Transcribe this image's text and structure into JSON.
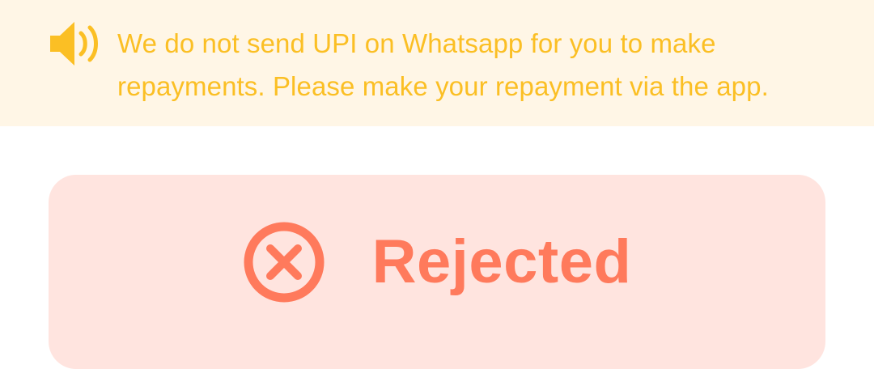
{
  "notice": {
    "icon": "speaker-icon",
    "line1": "We do not send UPI on Whatsapp for you to make",
    "line2": "repayments. Please make your repayment via the app.",
    "color": "#fbbf24",
    "background": "#fff6e6"
  },
  "status": {
    "label": "Rejected",
    "icon": "rejected-circle-x-icon",
    "color": "#ff7a5c",
    "background": "#ffe4df"
  }
}
